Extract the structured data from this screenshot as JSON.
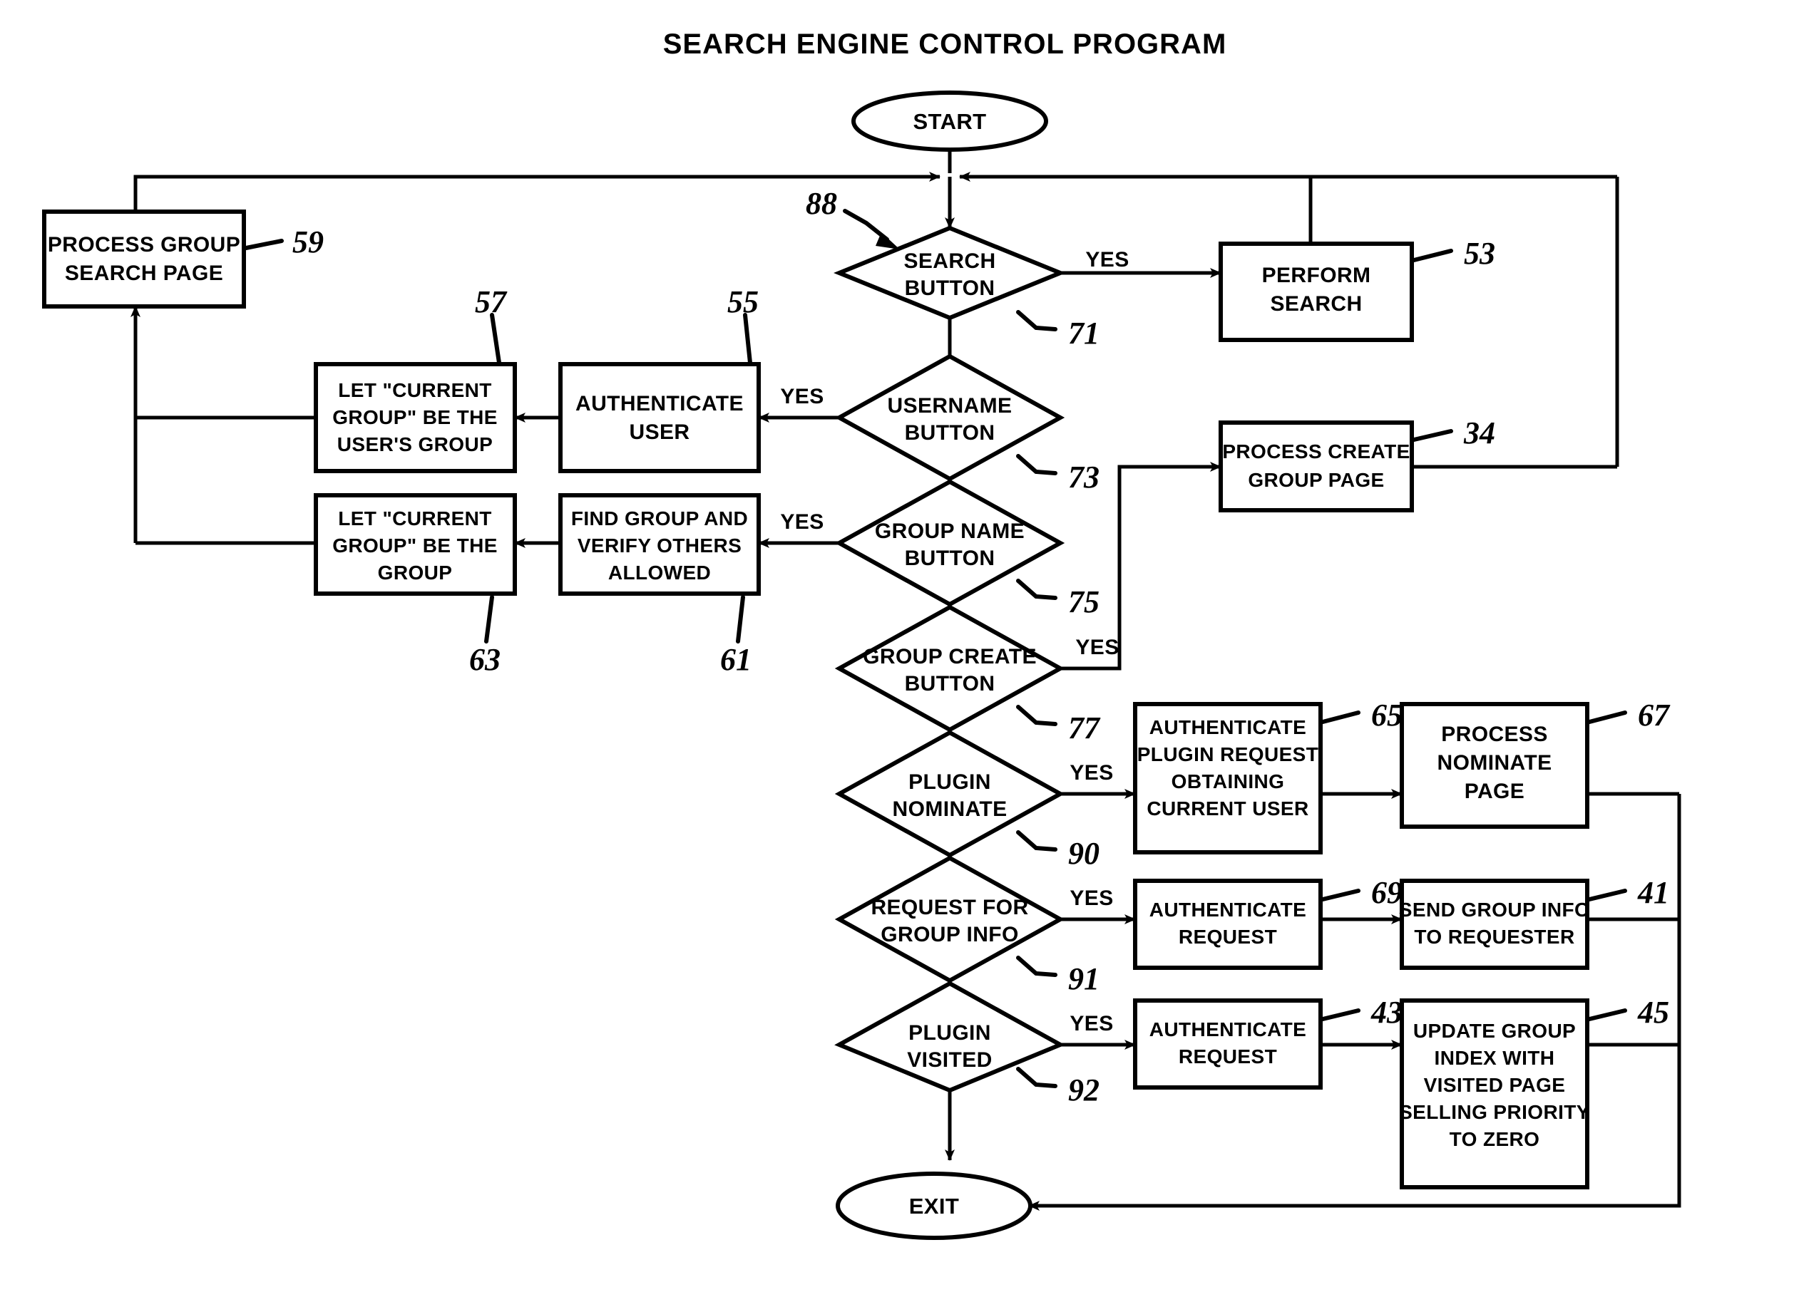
{
  "figure": {
    "title": "SEARCH ENGINE CONTROL PROGRAM",
    "type": "flowchart",
    "line_color": "#000000",
    "background_color": "#ffffff"
  },
  "terminals": [
    {
      "id": "start",
      "label": "START",
      "shape": "ellipse"
    },
    {
      "id": "exit",
      "label": "EXIT",
      "shape": "ellipse"
    }
  ],
  "decisions": [
    {
      "id": "d71",
      "label_line1": "SEARCH",
      "label_line2": "BUTTON",
      "ref": "71",
      "yes_label": "YES",
      "yes_direction": "right"
    },
    {
      "id": "d73",
      "label_line1": "USERNAME",
      "label_line2": "BUTTON",
      "ref": "73",
      "yes_label": "YES",
      "yes_direction": "left"
    },
    {
      "id": "d75",
      "label_line1": "GROUP NAME",
      "label_line2": "BUTTON",
      "ref": "75",
      "yes_label": "YES",
      "yes_direction": "left"
    },
    {
      "id": "d77",
      "label_line1": "GROUP CREATE",
      "label_line2": "BUTTON",
      "ref": "77",
      "yes_label": "YES",
      "yes_direction": "right"
    },
    {
      "id": "d90",
      "label_line1": "PLUGIN",
      "label_line2": "NOMINATE",
      "ref": "90",
      "yes_label": "YES",
      "yes_direction": "right"
    },
    {
      "id": "d91",
      "label_line1": "REQUEST FOR",
      "label_line2": "GROUP INFO",
      "ref": "91",
      "yes_label": "YES",
      "yes_direction": "right"
    },
    {
      "id": "d92",
      "label_line1": "PLUGIN",
      "label_line2": "VISITED",
      "ref": "92",
      "yes_label": "YES",
      "yes_direction": "right"
    }
  ],
  "processes": [
    {
      "id": "p59",
      "ref": "59",
      "lines": [
        "PROCESS GROUP",
        "SEARCH PAGE"
      ]
    },
    {
      "id": "p57",
      "ref": "57",
      "lines": [
        "LET \"CURRENT",
        "GROUP\" BE THE",
        "USER'S GROUP"
      ]
    },
    {
      "id": "p55",
      "ref": "55",
      "lines": [
        "AUTHENTICATE",
        "USER"
      ]
    },
    {
      "id": "p63",
      "ref": "63",
      "lines": [
        "LET \"CURRENT",
        "GROUP\" BE THE",
        "GROUP"
      ]
    },
    {
      "id": "p61",
      "ref": "61",
      "lines": [
        "FIND GROUP AND",
        "VERIFY OTHERS",
        "ALLOWED"
      ]
    },
    {
      "id": "p53",
      "ref": "53",
      "lines": [
        "PERFORM",
        "SEARCH"
      ]
    },
    {
      "id": "p34",
      "ref": "34",
      "lines": [
        "PROCESS CREATE",
        "GROUP PAGE"
      ]
    },
    {
      "id": "p65",
      "ref": "65",
      "lines": [
        "AUTHENTICATE",
        "PLUGIN REQUEST",
        "OBTAINING",
        "CURRENT USER"
      ]
    },
    {
      "id": "p67",
      "ref": "67",
      "lines": [
        "PROCESS",
        "NOMINATE",
        "PAGE"
      ]
    },
    {
      "id": "p69",
      "ref": "69",
      "lines": [
        "AUTHENTICATE",
        "REQUEST"
      ]
    },
    {
      "id": "p41",
      "ref": "41",
      "lines": [
        "SEND GROUP INFO",
        "TO REQUESTER"
      ]
    },
    {
      "id": "p43",
      "ref": "43",
      "lines": [
        "AUTHENTICATE",
        "REQUEST"
      ]
    },
    {
      "id": "p45",
      "ref": "45",
      "lines": [
        "UPDATE GROUP",
        "INDEX WITH",
        "VISITED PAGE",
        "SELLING PRIORITY",
        "TO ZERO"
      ]
    }
  ],
  "annotations": [
    {
      "id": "a88",
      "ref": "88",
      "points_to": "d71"
    }
  ],
  "labels": {
    "yes": "YES"
  }
}
